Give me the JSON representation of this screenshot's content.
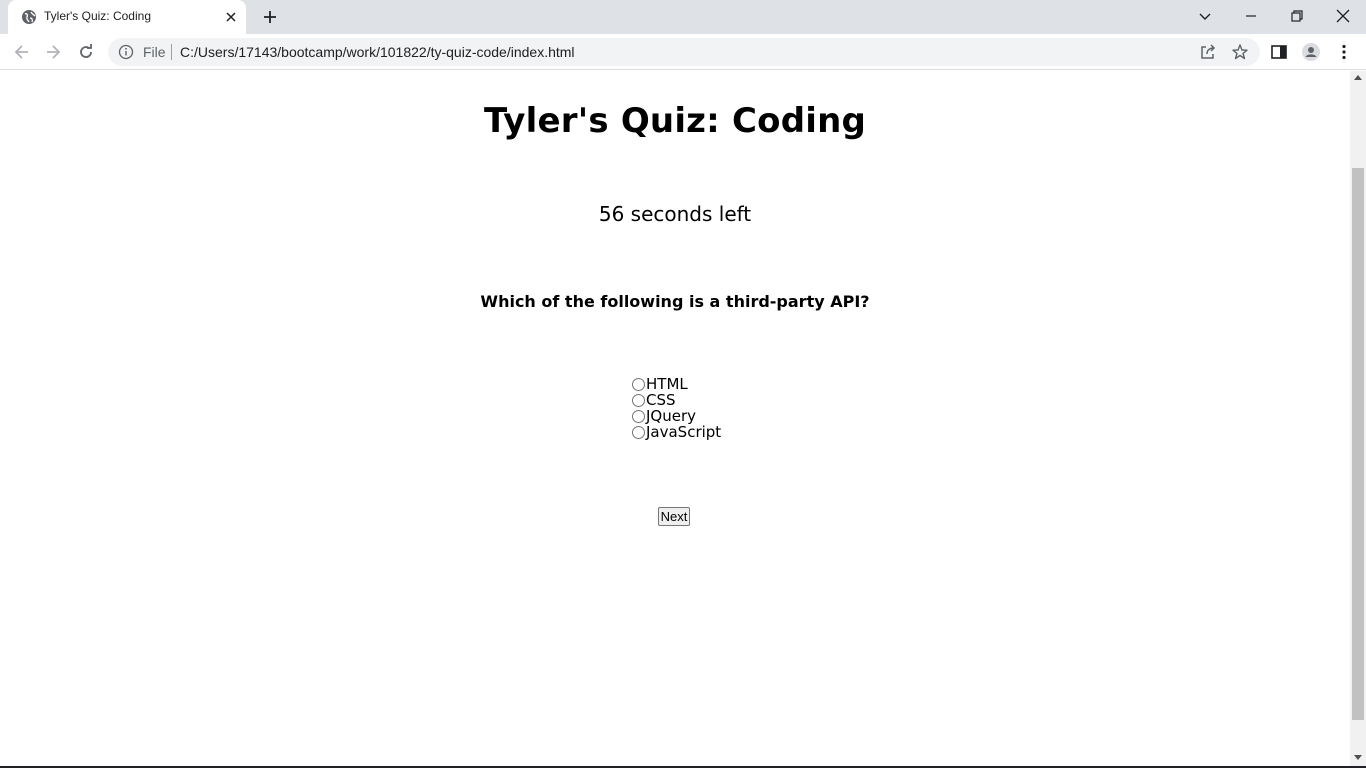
{
  "browser": {
    "tab_title": "Tyler's Quiz: Coding",
    "scheme_label": "File",
    "url": "C:/Users/17143/bootcamp/work/101822/ty-quiz-code/index.html"
  },
  "page": {
    "title": "Tyler's Quiz: Coding",
    "timer_text": "56 seconds left",
    "question": "Which of the following is a third-party API?",
    "choices": [
      "HTML",
      "CSS",
      "JQuery",
      "JavaScript"
    ],
    "next_label": "Next"
  },
  "icons": {
    "favicon": "globe-icon",
    "tab_close": "close-icon",
    "new_tab": "plus-icon",
    "back": "arrow-left-icon",
    "forward": "arrow-right-icon",
    "reload": "reload-icon",
    "info": "info-icon",
    "share": "share-icon",
    "bookmark": "star-icon",
    "side_panel": "side-panel-icon",
    "profile": "profile-icon",
    "menu": "kebab-menu-icon"
  }
}
